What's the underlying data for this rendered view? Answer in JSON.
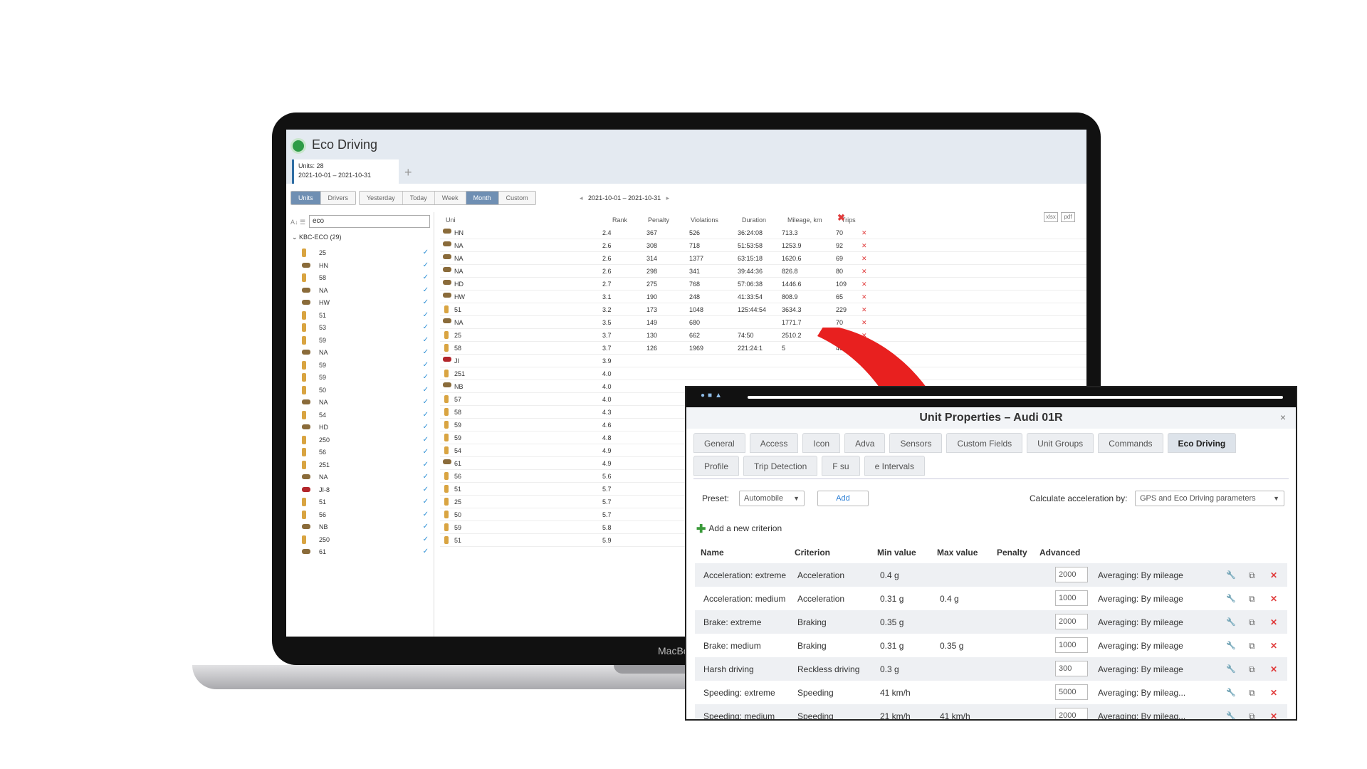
{
  "app": {
    "title": "Eco Driving",
    "units_label": "Units: 28",
    "date_range": "2021-10-01 – 2021-10-31",
    "plus": "+",
    "view_tabs": [
      "Units",
      "Drivers"
    ],
    "period_tabs": [
      "Yesterday",
      "Today",
      "Week",
      "Month",
      "Custom"
    ],
    "active_period": "Month",
    "range_text": "2021-10-01 – 2021-10-31",
    "search_value": "eco",
    "group_label": "KBC-ECO (29)",
    "export": [
      "xlsx",
      "pdf"
    ],
    "laptop_brand": "MacBo"
  },
  "sidebar_units": [
    "25",
    "HN",
    "58",
    "NA",
    "HW",
    "51",
    "53",
    "59",
    "NA",
    "59",
    "59",
    "50",
    "NA",
    "54",
    "HD",
    "250",
    "56",
    "251",
    "NA",
    "JI-8",
    "51",
    "56",
    "NB",
    "250",
    "61"
  ],
  "table": {
    "headers": [
      "Uni",
      "Rank",
      "Penalty",
      "Violations",
      "Duration",
      "Mileage, km",
      "Trips"
    ],
    "rows": [
      {
        "u": "HN",
        "rank": "2.4",
        "pen": "367",
        "vio": "526",
        "dur": "36:24:08",
        "mil": "713.3",
        "trips": "70"
      },
      {
        "u": "NA",
        "rank": "2.6",
        "pen": "308",
        "vio": "718",
        "dur": "51:53:58",
        "mil": "1253.9",
        "trips": "92"
      },
      {
        "u": "NA",
        "rank": "2.6",
        "pen": "314",
        "vio": "1377",
        "dur": "63:15:18",
        "mil": "1620.6",
        "trips": "69"
      },
      {
        "u": "NA",
        "rank": "2.6",
        "pen": "298",
        "vio": "341",
        "dur": "39:44:36",
        "mil": "826.8",
        "trips": "80"
      },
      {
        "u": "HD",
        "rank": "2.7",
        "pen": "275",
        "vio": "768",
        "dur": "57:06:38",
        "mil": "1446.6",
        "trips": "109"
      },
      {
        "u": "HW",
        "rank": "3.1",
        "pen": "190",
        "vio": "248",
        "dur": "41:33:54",
        "mil": "808.9",
        "trips": "65"
      },
      {
        "u": "51",
        "rank": "3.2",
        "pen": "173",
        "vio": "1048",
        "dur": "125:44:54",
        "mil": "3634.3",
        "trips": "229"
      },
      {
        "u": "NA",
        "rank": "3.5",
        "pen": "149",
        "vio": "680",
        "dur": "",
        "mil": "1771.7",
        "trips": "70"
      },
      {
        "u": "25",
        "rank": "3.7",
        "pen": "130",
        "vio": "662",
        "dur": "74:50",
        "mil": "2510.2",
        "trips": "129"
      },
      {
        "u": "58",
        "rank": "3.7",
        "pen": "126",
        "vio": "1969",
        "dur": "221:24:1",
        "mil": "5",
        "trips": "460"
      },
      {
        "u": "JI",
        "rank": "3.9"
      },
      {
        "u": "251",
        "rank": "4.0"
      },
      {
        "u": "NB",
        "rank": "4.0"
      },
      {
        "u": "57",
        "rank": "4.0"
      },
      {
        "u": "58",
        "rank": "4.3"
      },
      {
        "u": "59",
        "rank": "4.6"
      },
      {
        "u": "59",
        "rank": "4.8"
      },
      {
        "u": "54",
        "rank": "4.9"
      },
      {
        "u": "61",
        "rank": "4.9"
      },
      {
        "u": "56",
        "rank": "5.6"
      },
      {
        "u": "51",
        "rank": "5.7"
      },
      {
        "u": "25",
        "rank": "5.7"
      },
      {
        "u": "50",
        "rank": "5.7"
      },
      {
        "u": "59",
        "rank": "5.8"
      },
      {
        "u": "51",
        "rank": "5.9"
      }
    ]
  },
  "dialog": {
    "title": "Unit Properties – Audi 01R",
    "close": "×",
    "tabs_row1": [
      "General",
      "Access",
      "Icon",
      "Adva",
      "Sensors",
      "Custom Fields",
      "Unit Groups",
      "Commands",
      "Eco Driving"
    ],
    "tabs_row2": [
      "Profile",
      "Trip Detection",
      "F     su",
      "e Intervals"
    ],
    "active_tab": "Eco Driving",
    "preset_label": "Preset:",
    "preset_value": "Automobile",
    "add_button": "Add",
    "calc_label": "Calculate acceleration by:",
    "calc_value": "GPS and Eco Driving parameters",
    "add_criterion": "Add a new criterion",
    "headers": [
      "Name",
      "Criterion",
      "Min value",
      "Max value",
      "Penalty",
      "Advanced"
    ],
    "criteria": [
      {
        "name": "Acceleration: extreme",
        "crit": "Acceleration",
        "min": "0.4 g",
        "max": "",
        "pen": "2000",
        "adv": "Averaging: By mileage"
      },
      {
        "name": "Acceleration: medium",
        "crit": "Acceleration",
        "min": "0.31 g",
        "max": "0.4 g",
        "pen": "1000",
        "adv": "Averaging: By mileage"
      },
      {
        "name": "Brake: extreme",
        "crit": "Braking",
        "min": "0.35 g",
        "max": "",
        "pen": "2000",
        "adv": "Averaging: By mileage"
      },
      {
        "name": "Brake: medium",
        "crit": "Braking",
        "min": "0.31 g",
        "max": "0.35 g",
        "pen": "1000",
        "adv": "Averaging: By mileage"
      },
      {
        "name": "Harsh driving",
        "crit": "Reckless driving",
        "min": "0.3 g",
        "max": "",
        "pen": "300",
        "adv": "Averaging: By mileage"
      },
      {
        "name": "Speeding: extreme",
        "crit": "Speeding",
        "min": "41 km/h",
        "max": "",
        "pen": "5000",
        "adv": "Averaging: By mileag..."
      },
      {
        "name": "Speeding: medium",
        "crit": "Speeding",
        "min": "21 km/h",
        "max": "41 km/h",
        "pen": "2000",
        "adv": "Averaging: By mileag..."
      }
    ]
  },
  "colors": {
    "accent": "#2d7fd5",
    "arrow": "#e8201f",
    "danger": "#e03b3b",
    "tab_active": "#6f8fb3"
  }
}
